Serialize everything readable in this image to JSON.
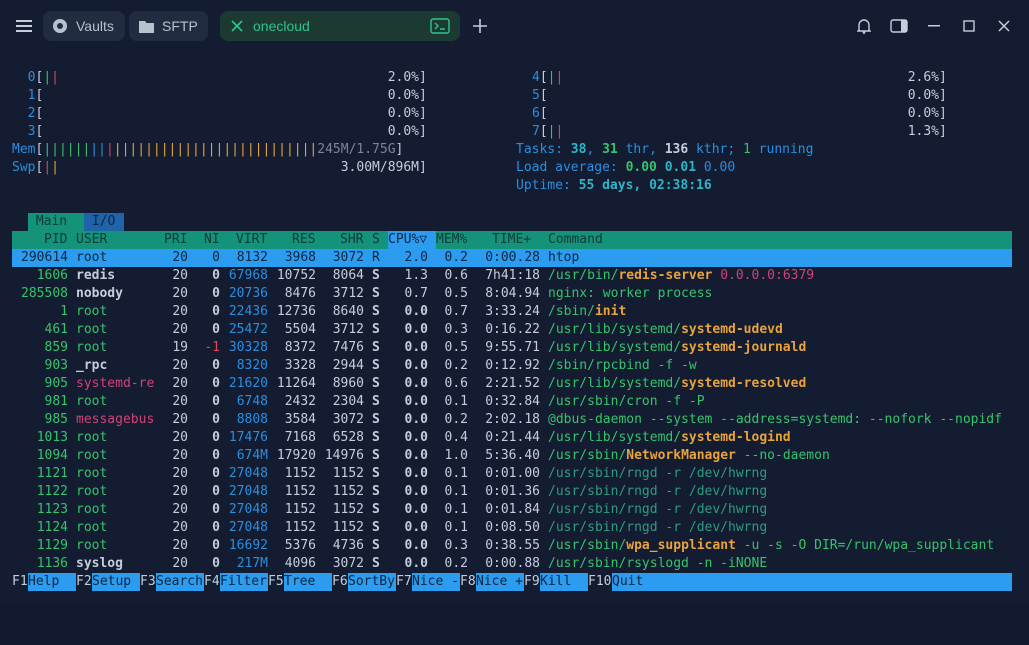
{
  "titlebar": {
    "tabs": [
      {
        "label": "Vaults",
        "icon": "vault-icon"
      },
      {
        "label": "SFTP",
        "icon": "folder-icon"
      },
      {
        "label": "onecloud",
        "icon": "terminal-icon"
      }
    ]
  },
  "cpu": [
    {
      "id": "0",
      "pct": "2.0%"
    },
    {
      "id": "1",
      "pct": "0.0%"
    },
    {
      "id": "2",
      "pct": "0.0%"
    },
    {
      "id": "3",
      "pct": "0.0%"
    },
    {
      "id": "4",
      "pct": "2.6%"
    },
    {
      "id": "5",
      "pct": "0.0%"
    },
    {
      "id": "6",
      "pct": "0.0%"
    },
    {
      "id": "7",
      "pct": "1.3%"
    }
  ],
  "mem": {
    "label": "Mem",
    "value": "245M/1.75G"
  },
  "swp": {
    "label": "Swp",
    "value": "3.00M/896M"
  },
  "tasks": {
    "label": "Tasks:",
    "tasks": "38",
    "thr": "31",
    "thr_label": "thr,",
    "kthr": "136",
    "kthr_label": "kthr;",
    "running": "1",
    "running_label": "running"
  },
  "load": {
    "label": "Load average:",
    "l1": "0.00",
    "l5": "0.01",
    "l15": "0.00"
  },
  "uptime": {
    "label": "Uptime:",
    "value": "55 days, 02:38:16"
  },
  "subtabs": {
    "main": "Main",
    "io": "I/O"
  },
  "header": {
    "pid": "PID",
    "user": "USER",
    "pri": "PRI",
    "ni": "NI",
    "virt": "VIRT",
    "res": "RES",
    "shr": "SHR",
    "s": "S",
    "cpu": "CPU%▽",
    "mem": "MEM%",
    "time": "TIME+",
    "cmd": "Command"
  },
  "processes": [
    {
      "pid": "290614",
      "user": "root",
      "pri": "20",
      "ni": "0",
      "virt": "8132",
      "res": "3968",
      "shr": "3072",
      "s": "R",
      "cpu": "2.0",
      "mem": "0.2",
      "time": "0:00.28",
      "cmd": "htop",
      "cmd_pre": "",
      "cmd_bold": "",
      "cmd_post": ""
    },
    {
      "pid": "1606",
      "user": "redis",
      "pri": "20",
      "ni": "0",
      "virt": "67968",
      "res": "10752",
      "shr": "8064",
      "s": "S",
      "cpu": "1.3",
      "mem": "0.6",
      "time": "7h41:18",
      "cmd_pre": "/usr/bin/",
      "cmd_bold": "redis-server",
      "cmd_post": " 0.0.0.0:6379"
    },
    {
      "pid": "285508",
      "user": "nobody",
      "pri": "20",
      "ni": "0",
      "virt": "20736",
      "res": "8476",
      "shr": "3712",
      "s": "S",
      "cpu": "0.7",
      "mem": "0.5",
      "time": "8:04.94",
      "cmd_pre": "nginx: worker process",
      "cmd_bold": "",
      "cmd_post": ""
    },
    {
      "pid": "1",
      "user": "root",
      "pri": "20",
      "ni": "0",
      "virt": "22436",
      "res": "12736",
      "shr": "8640",
      "s": "S",
      "cpu": "0.0",
      "mem": "0.7",
      "time": "3:33.24",
      "cmd_pre": "/sbin/",
      "cmd_bold": "init",
      "cmd_post": ""
    },
    {
      "pid": "461",
      "user": "root",
      "pri": "20",
      "ni": "0",
      "virt": "25472",
      "res": "5504",
      "shr": "3712",
      "s": "S",
      "cpu": "0.0",
      "mem": "0.3",
      "time": "0:16.22",
      "cmd_pre": "/usr/lib/systemd/",
      "cmd_bold": "systemd-udevd",
      "cmd_post": ""
    },
    {
      "pid": "859",
      "user": "root",
      "pri": "19",
      "ni": "-1",
      "virt": "30328",
      "res": "8372",
      "shr": "7476",
      "s": "S",
      "cpu": "0.0",
      "mem": "0.5",
      "time": "9:55.71",
      "cmd_pre": "/usr/lib/systemd/",
      "cmd_bold": "systemd-journald",
      "cmd_post": ""
    },
    {
      "pid": "903",
      "user": "_rpc",
      "pri": "20",
      "ni": "0",
      "virt": "8320",
      "res": "3328",
      "shr": "2944",
      "s": "S",
      "cpu": "0.0",
      "mem": "0.2",
      "time": "0:12.92",
      "cmd_pre": "/sbin/rpcbind -f -w",
      "cmd_bold": "",
      "cmd_post": ""
    },
    {
      "pid": "905",
      "user": "systemd-re",
      "pri": "20",
      "ni": "0",
      "virt": "21620",
      "res": "11264",
      "shr": "8960",
      "s": "S",
      "cpu": "0.0",
      "mem": "0.6",
      "time": "2:21.52",
      "cmd_pre": "/usr/lib/systemd/",
      "cmd_bold": "systemd-resolved",
      "cmd_post": ""
    },
    {
      "pid": "981",
      "user": "root",
      "pri": "20",
      "ni": "0",
      "virt": "6748",
      "res": "2432",
      "shr": "2304",
      "s": "S",
      "cpu": "0.0",
      "mem": "0.1",
      "time": "0:32.84",
      "cmd_pre": "/usr/sbin/cron -f -P",
      "cmd_bold": "",
      "cmd_post": ""
    },
    {
      "pid": "985",
      "user": "messagebus",
      "pri": "20",
      "ni": "0",
      "virt": "8808",
      "res": "3584",
      "shr": "3072",
      "s": "S",
      "cpu": "0.0",
      "mem": "0.2",
      "time": "2:02.18",
      "cmd_pre": "@dbus-daemon --system --address=systemd: --nofork --nopidf",
      "cmd_bold": "",
      "cmd_post": ""
    },
    {
      "pid": "1013",
      "user": "root",
      "pri": "20",
      "ni": "0",
      "virt": "17476",
      "res": "7168",
      "shr": "6528",
      "s": "S",
      "cpu": "0.0",
      "mem": "0.4",
      "time": "0:21.44",
      "cmd_pre": "/usr/lib/systemd/",
      "cmd_bold": "systemd-logind",
      "cmd_post": ""
    },
    {
      "pid": "1094",
      "user": "root",
      "pri": "20",
      "ni": "0",
      "virt": "674M",
      "res": "17920",
      "shr": "14976",
      "s": "S",
      "cpu": "0.0",
      "mem": "1.0",
      "time": "5:36.40",
      "cmd_pre": "/usr/sbin/",
      "cmd_bold": "NetworkManager",
      "cmd_post": " --no-daemon"
    },
    {
      "pid": "1121",
      "user": "root",
      "pri": "20",
      "ni": "0",
      "virt": "27048",
      "res": "1152",
      "shr": "1152",
      "s": "S",
      "cpu": "0.0",
      "mem": "0.1",
      "time": "0:01.00",
      "cmd_pre": "/usr/sbin/rngd -r /dev/hwrng",
      "cmd_bold": "",
      "cmd_post": "",
      "thread": true
    },
    {
      "pid": "1122",
      "user": "root",
      "pri": "20",
      "ni": "0",
      "virt": "27048",
      "res": "1152",
      "shr": "1152",
      "s": "S",
      "cpu": "0.0",
      "mem": "0.1",
      "time": "0:01.36",
      "cmd_pre": "/usr/sbin/rngd -r /dev/hwrng",
      "cmd_bold": "",
      "cmd_post": "",
      "thread": true
    },
    {
      "pid": "1123",
      "user": "root",
      "pri": "20",
      "ni": "0",
      "virt": "27048",
      "res": "1152",
      "shr": "1152",
      "s": "S",
      "cpu": "0.0",
      "mem": "0.1",
      "time": "0:01.84",
      "cmd_pre": "/usr/sbin/rngd -r /dev/hwrng",
      "cmd_bold": "",
      "cmd_post": "",
      "thread": true
    },
    {
      "pid": "1124",
      "user": "root",
      "pri": "20",
      "ni": "0",
      "virt": "27048",
      "res": "1152",
      "shr": "1152",
      "s": "S",
      "cpu": "0.0",
      "mem": "0.1",
      "time": "0:08.50",
      "cmd_pre": "/usr/sbin/rngd -r /dev/hwrng",
      "cmd_bold": "",
      "cmd_post": "",
      "thread": true
    },
    {
      "pid": "1129",
      "user": "root",
      "pri": "20",
      "ni": "0",
      "virt": "16692",
      "res": "5376",
      "shr": "4736",
      "s": "S",
      "cpu": "0.0",
      "mem": "0.3",
      "time": "0:38.55",
      "cmd_pre": "/usr/sbin/",
      "cmd_bold": "wpa_supplicant",
      "cmd_post": " -u -s -O DIR=/run/wpa_supplicant"
    },
    {
      "pid": "1136",
      "user": "syslog",
      "pri": "20",
      "ni": "0",
      "virt": "217M",
      "res": "4096",
      "shr": "3072",
      "s": "S",
      "cpu": "0.0",
      "mem": "0.2",
      "time": "0:00.88",
      "cmd_pre": "/usr/sbin/rsyslogd -n -iNONE",
      "cmd_bold": "",
      "cmd_post": ""
    }
  ],
  "fkeys": [
    {
      "key": "F1",
      "label": "Help  "
    },
    {
      "key": "F2",
      "label": "Setup "
    },
    {
      "key": "F3",
      "label": "Search"
    },
    {
      "key": "F4",
      "label": "Filter"
    },
    {
      "key": "F5",
      "label": "Tree  "
    },
    {
      "key": "F6",
      "label": "SortBy"
    },
    {
      "key": "F7",
      "label": "Nice -"
    },
    {
      "key": "F8",
      "label": "Nice +"
    },
    {
      "key": "F9",
      "label": "Kill  "
    },
    {
      "key": "F10",
      "label": "Quit  "
    }
  ],
  "colors": {
    "bg": "#131c30",
    "accent_green": "#2dc48d",
    "header_bar": "#14927a",
    "selection": "#2c9cf0"
  }
}
